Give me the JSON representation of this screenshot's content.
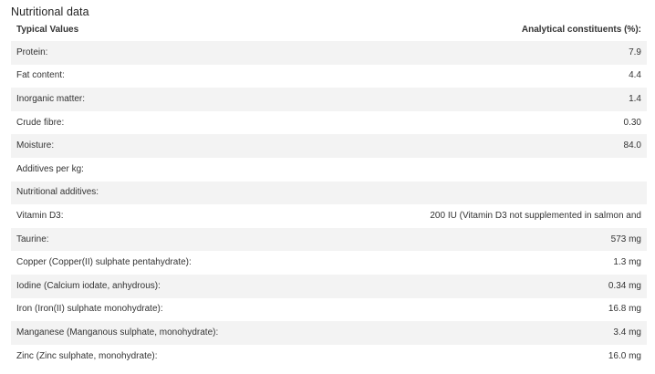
{
  "section": {
    "title": "Nutritional data"
  },
  "table": {
    "headers": {
      "label": "Typical Values",
      "value": "Analytical constituents (%):"
    },
    "rows": [
      {
        "label": "Protein:",
        "value": "7.9"
      },
      {
        "label": "Fat content:",
        "value": "4.4"
      },
      {
        "label": "Inorganic matter:",
        "value": "1.4"
      },
      {
        "label": "Crude fibre:",
        "value": "0.30"
      },
      {
        "label": "Moisture:",
        "value": "84.0"
      },
      {
        "label": "Additives per kg:",
        "value": ""
      },
      {
        "label": "Nutritional additives:",
        "value": ""
      },
      {
        "label": "Vitamin D3:",
        "value": "200 IU (Vitamin D3 not supplemented in salmon and"
      },
      {
        "label": "Taurine:",
        "value": "573 mg"
      },
      {
        "label": "Copper (Copper(II) sulphate pentahydrate):",
        "value": "1.3 mg"
      },
      {
        "label": "Iodine (Calcium iodate, anhydrous):",
        "value": "0.34 mg"
      },
      {
        "label": "Iron (Iron(II) sulphate monohydrate):",
        "value": "16.8 mg"
      },
      {
        "label": "Manganese (Manganous sulphate, monohydrate):",
        "value": "3.4 mg"
      },
      {
        "label": "Zinc (Zinc sulphate, monohydrate):",
        "value": "16.0 mg"
      }
    ]
  }
}
